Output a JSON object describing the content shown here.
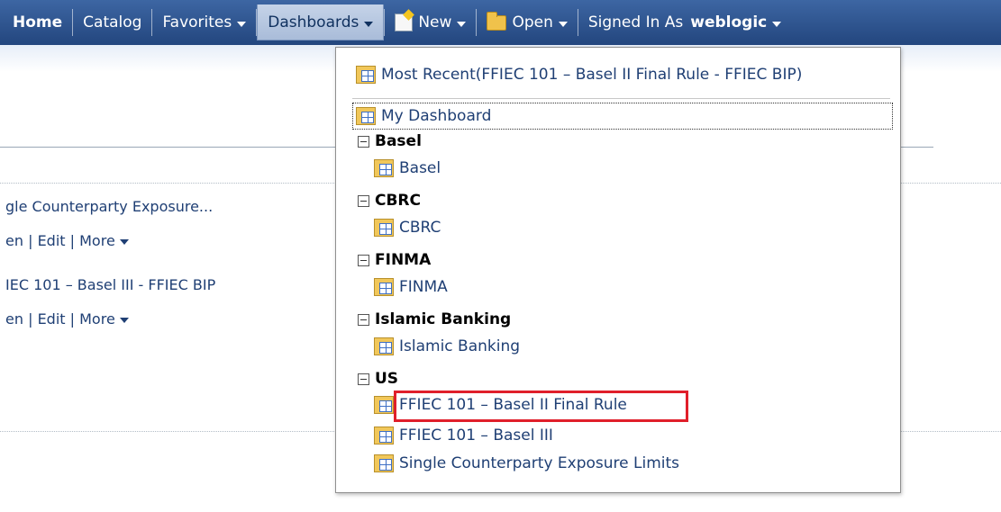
{
  "nav": {
    "home": "Home",
    "catalog": "Catalog",
    "favorites": "Favorites",
    "dashboards": "Dashboards",
    "new": "New",
    "open": "Open",
    "signed_in_label": "Signed In As",
    "user": "weblogic"
  },
  "background": {
    "item1_title": "gle Counterparty Exposure...",
    "item1_actions": {
      "open": "en",
      "sep1": "|",
      "edit": "Edit",
      "sep2": "|",
      "more": "More"
    },
    "item2_title": "IEC 101 – Basel III - FFIEC BIP",
    "item2_actions": {
      "open": "en",
      "sep1": "|",
      "edit": "Edit",
      "sep2": "|",
      "more": "More"
    }
  },
  "menu": {
    "most_recent": "Most Recent(FFIEC 101 – Basel II Final Rule - FFIEC BIP)",
    "my_dashboard": "My Dashboard",
    "groups": [
      {
        "name": "Basel",
        "items": [
          "Basel"
        ]
      },
      {
        "name": "CBRC",
        "items": [
          "CBRC"
        ]
      },
      {
        "name": "FINMA",
        "items": [
          "FINMA"
        ]
      },
      {
        "name": "Islamic Banking",
        "items": [
          "Islamic Banking"
        ]
      },
      {
        "name": "US",
        "items": [
          "FFIEC 101 – Basel II Final Rule",
          "FFIEC 101 – Basel III",
          "Single Counterparty Exposure Limits"
        ]
      }
    ]
  },
  "colors": {
    "nav_bg": "#2b4f8a",
    "highlight": "#e01f2a",
    "link": "#1f3f74"
  }
}
